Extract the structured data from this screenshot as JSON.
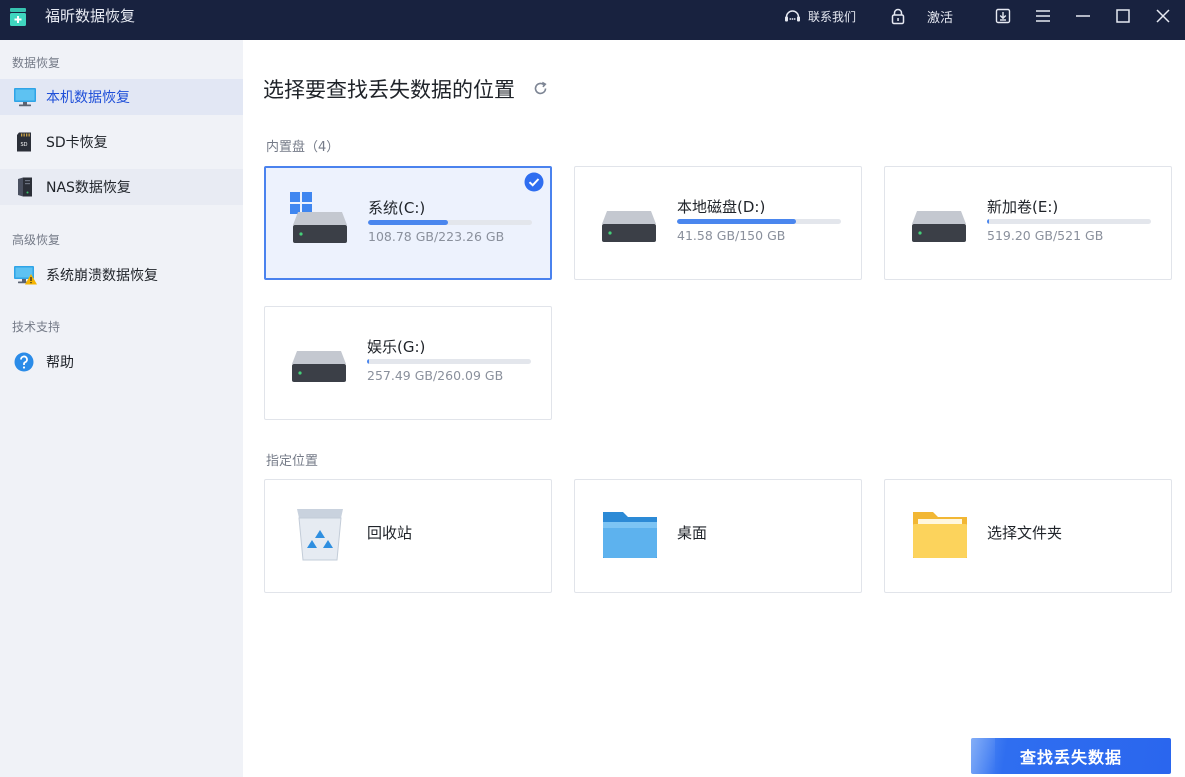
{
  "app": {
    "title": "福昕数据恢复"
  },
  "titlebar": {
    "contact_label": "联系我们",
    "activate_label": "激活"
  },
  "sidebar": {
    "sections": [
      {
        "label": "数据恢复",
        "items": [
          {
            "label": "本机数据恢复",
            "icon": "monitor-icon",
            "active": true
          },
          {
            "label": "SD卡恢复",
            "icon": "sd-card-icon",
            "active": false
          },
          {
            "label": "NAS数据恢复",
            "icon": "nas-icon",
            "active": false
          }
        ]
      },
      {
        "label": "高级恢复",
        "items": [
          {
            "label": "系统崩溃数据恢复",
            "icon": "system-crash-icon",
            "active": false
          }
        ]
      },
      {
        "label": "技术支持",
        "items": [
          {
            "label": "帮助",
            "icon": "help-icon",
            "active": false
          }
        ]
      }
    ]
  },
  "main": {
    "title": "选择要查找丢失数据的位置",
    "drives_group_label": "内置盘（4）",
    "drives": [
      {
        "name": "系统(C:)",
        "size": "108.78 GB/223.26 GB",
        "used_fraction": 0.487,
        "selected": true,
        "system": true
      },
      {
        "name": "本地磁盘(D:)",
        "size": "41.58 GB/150 GB",
        "used_fraction": 0.723,
        "selected": false,
        "system": false
      },
      {
        "name": "新加卷(E:)",
        "size": "519.20 GB/521 GB",
        "used_fraction": 0.015,
        "selected": false,
        "system": false
      },
      {
        "name": "娱乐(G:)",
        "size": "257.49 GB/260.09 GB",
        "used_fraction": 0.01,
        "selected": false,
        "system": false
      }
    ],
    "locations_group_label": "指定位置",
    "locations": [
      {
        "label": "回收站",
        "icon": "recycle-bin-icon"
      },
      {
        "label": "桌面",
        "icon": "desktop-folder-icon"
      },
      {
        "label": "选择文件夹",
        "icon": "folder-icon"
      }
    ],
    "scan_button_label": "查找丢失数据"
  },
  "colors": {
    "titlebar_bg": "#18223f",
    "accent": "#2f6ef0",
    "selected_card_bg": "#edf2fd",
    "sidebar_bg": "#f0f2f7"
  }
}
